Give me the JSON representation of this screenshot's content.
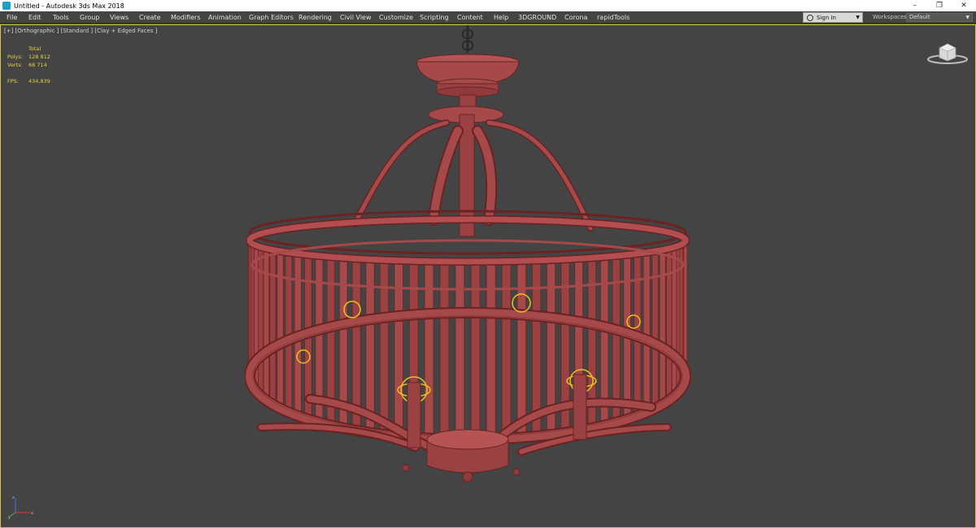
{
  "window": {
    "title": "Untitled - Autodesk 3ds Max 2018",
    "controls": [
      "–",
      "❐",
      "✕"
    ]
  },
  "menu": {
    "items": [
      "File",
      "Edit",
      "Tools",
      "Group",
      "Views",
      "Create",
      "Modifiers",
      "Animation",
      "Graph Editors",
      "Rendering",
      "Civil View",
      "Customize",
      "Scripting",
      "Content",
      "Help",
      "3DGROUND",
      "Corona",
      "rapidTools"
    ]
  },
  "signin": {
    "label": "Sign In"
  },
  "workspaces": {
    "label": "Workspaces:",
    "value": "Default"
  },
  "viewport": {
    "label": "[+] [Orthographic ] [Standard ] [Clay + Edged Faces ]",
    "stats": {
      "header": "Total",
      "polys_label": "Polys:",
      "polys_value": "128 812",
      "verts_label": "Verts:",
      "verts_value": "68 714",
      "fps_label": "FPS:",
      "fps_value": "434,839"
    }
  },
  "colors": {
    "model": "#a5494a",
    "wire": "#6b2222",
    "viewport_bg": "#444444",
    "active_border": "#d8c44a",
    "stats_text": "#e6d13a",
    "helper": "#e8c21f"
  },
  "icons": [
    "app-icon",
    "user-icon",
    "viewcube-icon",
    "axis-tripod-icon"
  ]
}
